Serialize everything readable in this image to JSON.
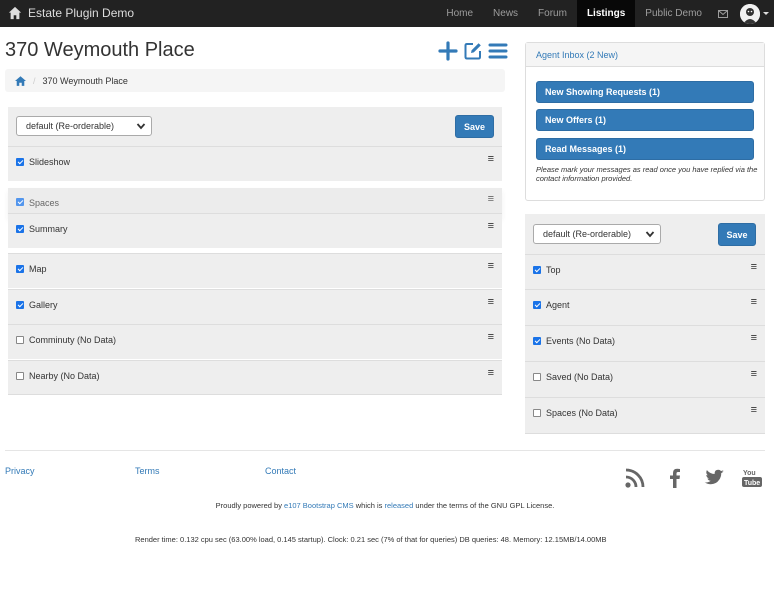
{
  "navbar": {
    "brand": "Estate Plugin Demo",
    "items": [
      {
        "label": "Home",
        "active": false
      },
      {
        "label": "News",
        "active": false
      },
      {
        "label": "Forum",
        "active": false
      },
      {
        "label": "Listings",
        "active": true
      },
      {
        "label": "Public Demo",
        "active": false
      }
    ],
    "mail_icon": "envelope-icon",
    "avatar_icon": "user-avatar"
  },
  "page": {
    "title": "370 Weymouth Place",
    "breadcrumb": {
      "current": "370 Weymouth Place"
    }
  },
  "main_panel": {
    "select_value": "default (Re-orderable)",
    "save_label": "Save",
    "items": [
      {
        "label": "Slideshow",
        "checked": true
      },
      {
        "label": "Spaces",
        "checked": true
      },
      {
        "label": "Summary",
        "checked": true
      },
      {
        "label": "Map",
        "checked": true
      },
      {
        "label": "Gallery",
        "checked": true
      },
      {
        "label": "Comminuty (No Data)",
        "checked": false
      },
      {
        "label": "Nearby (No Data)",
        "checked": false
      }
    ]
  },
  "inbox": {
    "header": "Agent Inbox (2 New)",
    "buttons": [
      "New Showing Requests (1)",
      "New Offers (1)",
      "Read Messages (1)"
    ],
    "note": "Please mark your messages as read once you have replied via the contact information provided."
  },
  "side_panel": {
    "select_value": "default (Re-orderable)",
    "save_label": "Save",
    "items": [
      {
        "label": "Top",
        "checked": true
      },
      {
        "label": "Agent",
        "checked": true
      },
      {
        "label": "Events (No Data)",
        "checked": true
      },
      {
        "label": "Saved (No Data)",
        "checked": false
      },
      {
        "label": "Spaces (No Data)",
        "checked": false
      }
    ]
  },
  "footer": {
    "links": [
      "Privacy",
      "Terms",
      "Contact"
    ],
    "social_icons": [
      "rss-icon",
      "facebook-icon",
      "twitter-icon",
      "youtube-icon"
    ],
    "powered": {
      "prefix": "Proudly powered by ",
      "cms_link": "e107 Bootstrap CMS",
      "middle": " which is ",
      "released_link": "released",
      "suffix": " under the terms of the GNU GPL License."
    },
    "render_stats": "Render time: 0.132 cpu sec (63.00% load, 0.145 startup). Clock: 0.21 sec (7% of that for queries)  DB queries: 48. Memory: 12.15MB/14.00MB"
  },
  "colors": {
    "navbar_bg": "#222222",
    "primary": "#337ab7",
    "panel_bg": "#eeeeee"
  }
}
